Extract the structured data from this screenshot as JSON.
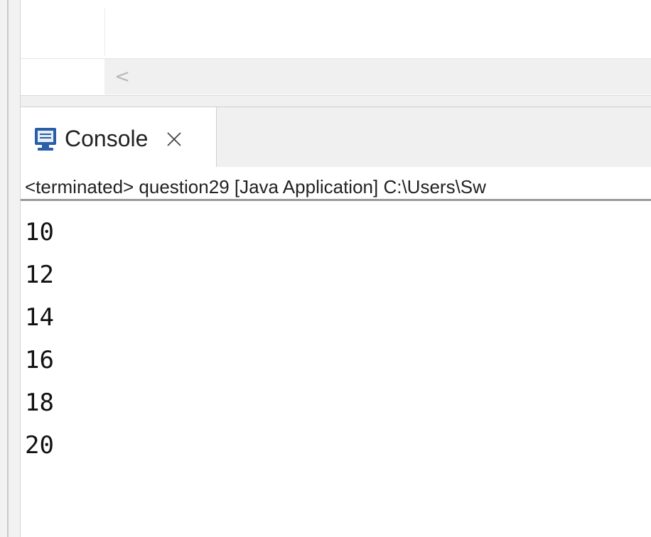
{
  "editor": {
    "scroll_left_arrow": "<"
  },
  "console": {
    "tab_label": "Console",
    "close_icon": "close-icon",
    "view_icon": "console-monitor-icon",
    "status_text": "<terminated> question29 [Java Application] C:\\Users\\Sw",
    "output_lines": [
      "10",
      "12",
      "14",
      "16",
      "18",
      "20"
    ]
  },
  "colors": {
    "icon_blue": "#2a5ea8",
    "frame": "#f0f0f0",
    "text": "#222222"
  }
}
